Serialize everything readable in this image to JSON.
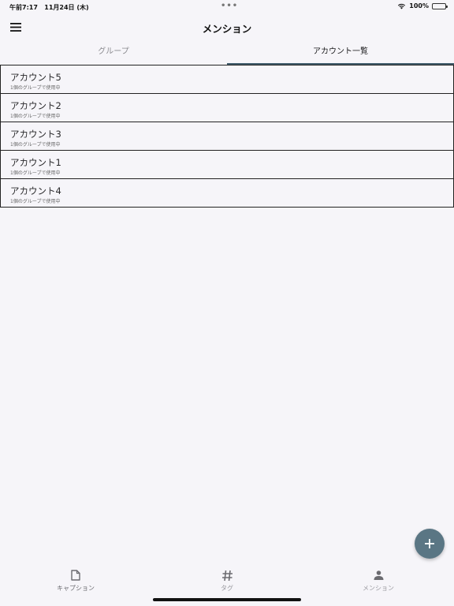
{
  "status_bar": {
    "time": "午前7:17",
    "date": "11月24日 (木)",
    "dots": "•••",
    "battery": "100%"
  },
  "app_bar": {
    "title": "メンション"
  },
  "tabs": [
    {
      "label": "グループ",
      "selected": false
    },
    {
      "label": "アカウント一覧",
      "selected": true
    }
  ],
  "accounts": [
    {
      "name": "アカウント5",
      "subtitle": "1個のグループで使用中"
    },
    {
      "name": "アカウント2",
      "subtitle": "1個のグループで使用中"
    },
    {
      "name": "アカウント3",
      "subtitle": "1個のグループで使用中"
    },
    {
      "name": "アカウント1",
      "subtitle": "1個のグループで使用中"
    },
    {
      "name": "アカウント4",
      "subtitle": "1個のグループで使用中"
    }
  ],
  "bottom_nav": [
    {
      "label": "キャプション",
      "icon": "document-icon"
    },
    {
      "label": "タグ",
      "icon": "hash-icon"
    },
    {
      "label": "メンション",
      "icon": "person-icon"
    }
  ],
  "colors": {
    "accent": "#5a7684",
    "tab_indicator": "#3f5c6b",
    "background": "#f6f5f9"
  }
}
